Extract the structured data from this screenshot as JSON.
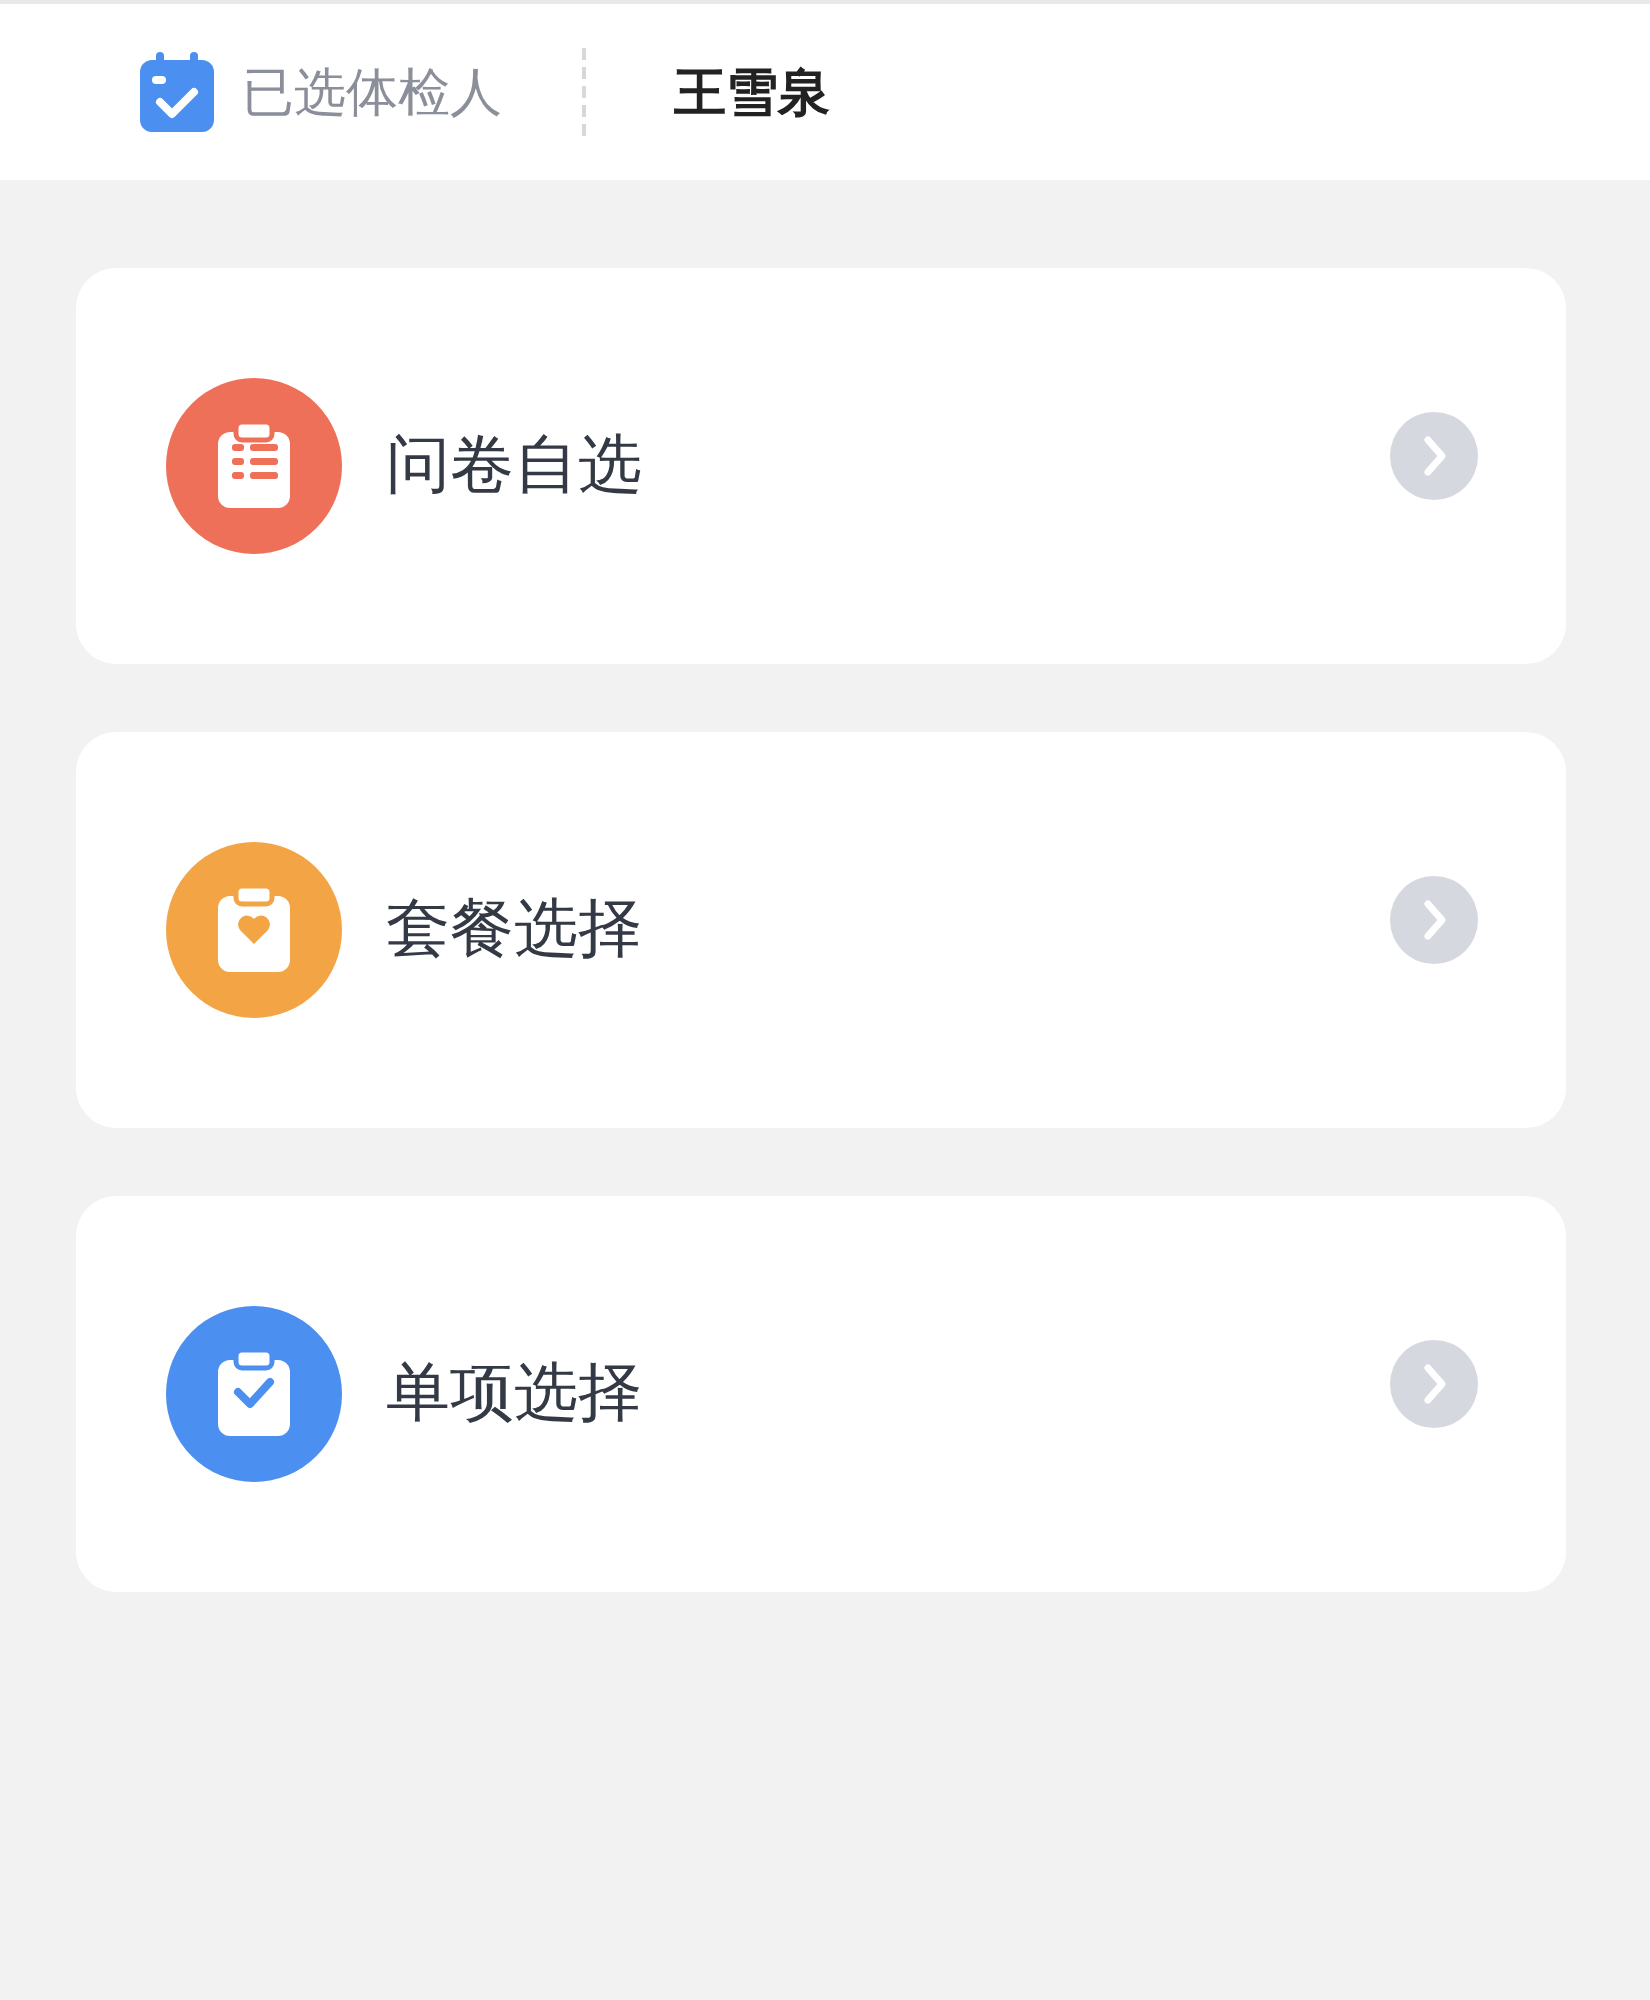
{
  "header": {
    "label": "已选体检人",
    "name": "王雪泉"
  },
  "options": [
    {
      "label": "问卷自选",
      "color": "#ef7058",
      "kind": "list"
    },
    {
      "label": "套餐选择",
      "color": "#f3a444",
      "kind": "heart"
    },
    {
      "label": "单项选择",
      "color": "#4b8ff0",
      "kind": "check"
    }
  ]
}
